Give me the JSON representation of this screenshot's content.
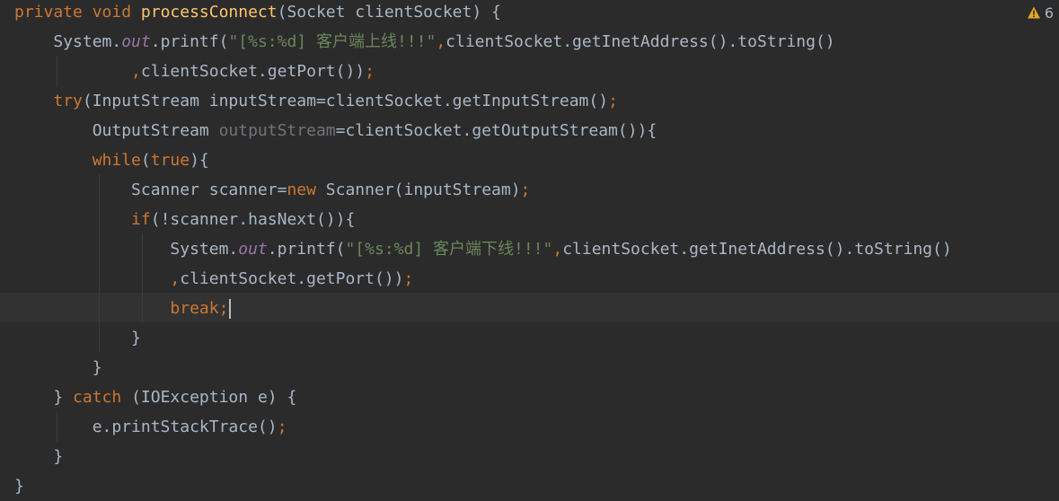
{
  "inspection": {
    "icon": "warning-triangle-icon",
    "warning_count": "6",
    "color": "#e0a722"
  },
  "colors": {
    "background": "#2b2b2b",
    "keyword": "#cc7832",
    "method": "#ffc66d",
    "string": "#6a8759",
    "field": "#9876aa",
    "text": "#a9b7c6",
    "unused": "#72737a"
  },
  "lines": [
    [
      {
        "t": "private void ",
        "c": "kw"
      },
      {
        "t": "processConnect",
        "c": "fn"
      },
      {
        "t": "(Socket clientSocket) {",
        "c": "txt"
      }
    ],
    [
      {
        "t": "    System.",
        "c": "txt"
      },
      {
        "t": "out",
        "c": "fld"
      },
      {
        "t": ".printf(",
        "c": "txt"
      },
      {
        "t": "\"[%s:%d] 客户端上线!!!\"",
        "c": "str"
      },
      {
        "t": ",",
        "c": "kw"
      },
      {
        "t": "clientSocket.getInetAddress().toString()",
        "c": "txt"
      }
    ],
    [
      {
        "t": "            ",
        "c": "txt"
      },
      {
        "t": ",",
        "c": "kw"
      },
      {
        "t": "clientSocket.getPort())",
        "c": "txt"
      },
      {
        "t": ";",
        "c": "kw"
      }
    ],
    [
      {
        "t": "    ",
        "c": "txt"
      },
      {
        "t": "try",
        "c": "kw"
      },
      {
        "t": "(InputStream inputStream=clientSocket.getInputStream()",
        "c": "txt"
      },
      {
        "t": ";",
        "c": "kw"
      }
    ],
    [
      {
        "t": "        OutputStream ",
        "c": "txt"
      },
      {
        "t": "outputStream",
        "c": "unused"
      },
      {
        "t": "=clientSocket.getOutputStream()){",
        "c": "txt"
      }
    ],
    [
      {
        "t": "        ",
        "c": "txt"
      },
      {
        "t": "while",
        "c": "kw"
      },
      {
        "t": "(",
        "c": "txt"
      },
      {
        "t": "true",
        "c": "kw"
      },
      {
        "t": "){",
        "c": "txt"
      }
    ],
    [
      {
        "t": "            Scanner scanner=",
        "c": "txt"
      },
      {
        "t": "new ",
        "c": "kw"
      },
      {
        "t": "Scanner(inputStream)",
        "c": "txt"
      },
      {
        "t": ";",
        "c": "kw"
      }
    ],
    [
      {
        "t": "            ",
        "c": "txt"
      },
      {
        "t": "if",
        "c": "kw"
      },
      {
        "t": "(!scanner.hasNext()){",
        "c": "txt"
      }
    ],
    [
      {
        "t": "                System.",
        "c": "txt"
      },
      {
        "t": "out",
        "c": "fld"
      },
      {
        "t": ".printf(",
        "c": "txt"
      },
      {
        "t": "\"[%s:%d] 客户端下线!!!\"",
        "c": "str"
      },
      {
        "t": ",",
        "c": "kw"
      },
      {
        "t": "clientSocket.getInetAddress().toString()",
        "c": "txt"
      }
    ],
    [
      {
        "t": "                ",
        "c": "txt"
      },
      {
        "t": ",",
        "c": "kw"
      },
      {
        "t": "clientSocket.getPort())",
        "c": "txt"
      },
      {
        "t": ";",
        "c": "kw"
      }
    ],
    [
      {
        "t": "                ",
        "c": "txt"
      },
      {
        "t": "break;",
        "c": "kw"
      }
    ],
    [
      {
        "t": "            }",
        "c": "txt"
      }
    ],
    [
      {
        "t": "        }",
        "c": "txt"
      }
    ],
    [
      {
        "t": "    } ",
        "c": "txt"
      },
      {
        "t": "catch ",
        "c": "kw"
      },
      {
        "t": "(IOException e) {",
        "c": "txt"
      }
    ],
    [
      {
        "t": "        e.printStackTrace()",
        "c": "txt"
      },
      {
        "t": ";",
        "c": "kw"
      }
    ],
    [
      {
        "t": "    }",
        "c": "txt"
      }
    ],
    [
      {
        "t": "}",
        "c": "txt"
      }
    ]
  ],
  "caret_line": 10
}
